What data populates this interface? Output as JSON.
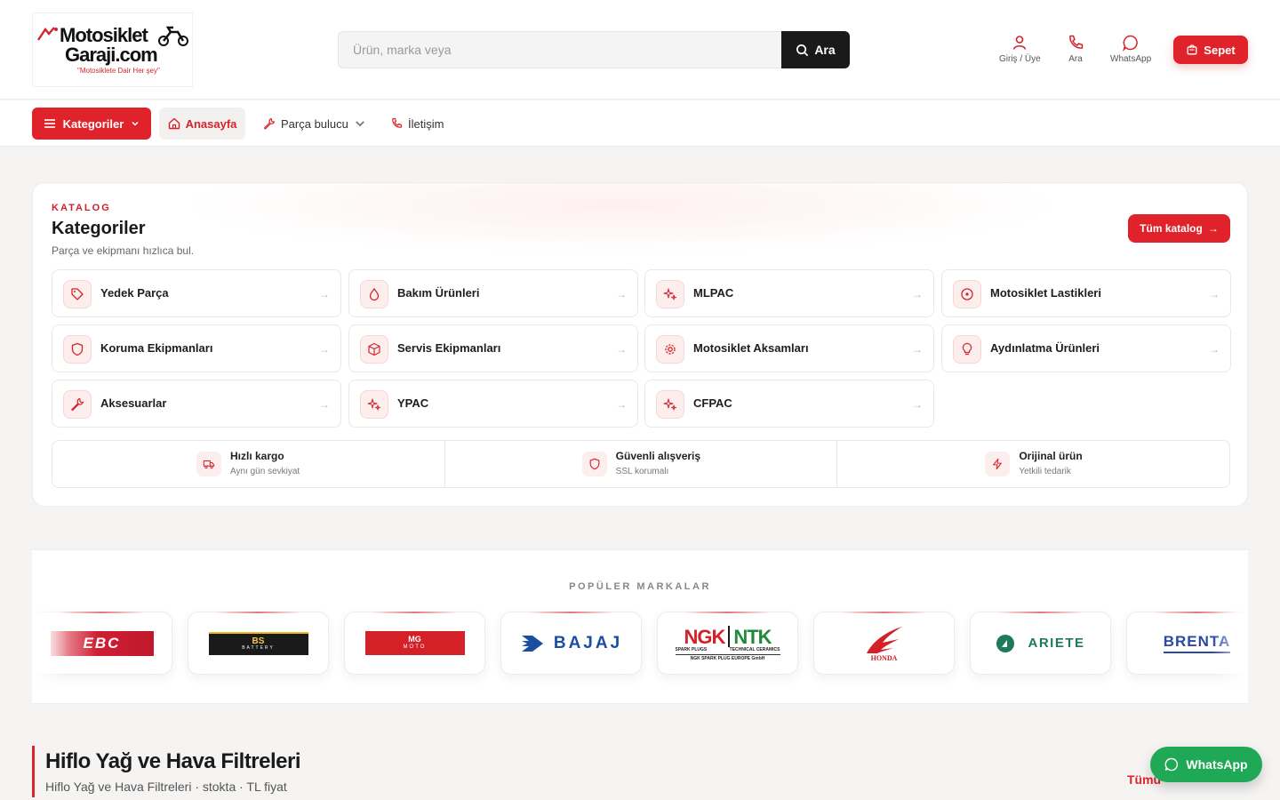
{
  "header": {
    "logo": {
      "line1": "Motosiklet",
      "line2": "Garaji.com",
      "tagline": "\"Motosiklete Dair Her şey\""
    },
    "search": {
      "placeholder": "Ürün, marka veya",
      "button_label": "Ara"
    },
    "actions": [
      {
        "label": "Giriş / Üye",
        "icon": "user-icon"
      },
      {
        "label": "Ara",
        "icon": "phone-icon"
      },
      {
        "label": "WhatsApp",
        "icon": "chat-icon"
      }
    ],
    "cart_label": "Sepet"
  },
  "nav": {
    "categories_label": "Kategoriler",
    "home_label": "Anasayfa",
    "parts_finder_label": "Parça bulucu",
    "contact_label": "İletişim"
  },
  "catalog": {
    "kicker": "KATALOG",
    "title": "Kategoriler",
    "subtitle": "Parça ve ekipmanı hızlıca bul.",
    "all_button": "Tüm katalog",
    "categories": [
      {
        "label": "Yedek Parça",
        "icon": "tag-icon"
      },
      {
        "label": "Bakım Ürünleri",
        "icon": "drop-icon"
      },
      {
        "label": "MLPAC",
        "icon": "sparkle-icon"
      },
      {
        "label": "Motosiklet Lastikleri",
        "icon": "tire-icon"
      },
      {
        "label": "Koruma Ekipmanları",
        "icon": "shield-icon"
      },
      {
        "label": "Servis Ekipmanları",
        "icon": "box-icon"
      },
      {
        "label": "Motosiklet Aksamları",
        "icon": "gear-icon"
      },
      {
        "label": "Aydınlatma Ürünleri",
        "icon": "bulb-icon"
      },
      {
        "label": "Aksesuarlar",
        "icon": "wrench-icon"
      },
      {
        "label": "YPAC",
        "icon": "sparkle-icon"
      },
      {
        "label": "CFPAC",
        "icon": "sparkle-icon"
      }
    ],
    "features": [
      {
        "title": "Hızlı kargo",
        "sub": "Aynı gün sevkiyat",
        "icon": "truck-icon"
      },
      {
        "title": "Güvenli alışveriş",
        "sub": "SSL korumalı",
        "icon": "shield-icon"
      },
      {
        "title": "Orijinal ürün",
        "sub": "Yetkili tedarik",
        "icon": "bolt-icon"
      }
    ]
  },
  "brands": {
    "title": "POPÜLER MARKALAR",
    "items": [
      "EBC",
      "BS",
      "BATTERY",
      "MG",
      "MOTO",
      "BAJAJ",
      "NGK",
      "NTK",
      "SPARK PLUGS",
      "TECHNICAL CERAMICS",
      "NGK SPARK PLUG EUROPE GmbH",
      "HONDA",
      "ARIETE",
      "BRENTA"
    ]
  },
  "section": {
    "title": "Hiflo Yağ ve Hava Filtreleri",
    "subtitle": "Hiflo Yağ ve Hava Filtreleri · stokta · TL fiyat",
    "all_link": "Tümü"
  },
  "whatsapp_float": "WhatsApp",
  "colors": {
    "accent": "#e0232b",
    "whatsapp": "#1fa855",
    "dark": "#1a1a1a"
  }
}
